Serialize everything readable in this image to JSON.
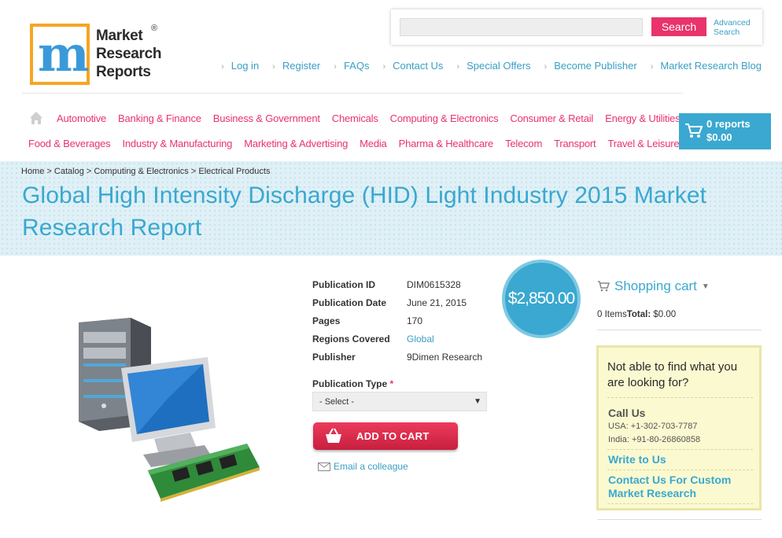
{
  "logo": {
    "line1": "Market",
    "line2": "Research",
    "line3": "Reports",
    "reg": "®"
  },
  "search": {
    "placeholder": "",
    "button": "Search",
    "advanced_line1": "Advanced",
    "advanced_line2": "Search"
  },
  "top_links": [
    "Log in",
    "Register",
    "FAQs",
    "Contact Us",
    "Special Offers",
    "Become Publisher",
    "Market Research Blog"
  ],
  "categories_row1": [
    "Automotive",
    "Banking & Finance",
    "Business & Government",
    "Chemicals",
    "Computing & Electronics",
    "Consumer & Retail",
    "Energy & Utilities"
  ],
  "categories_row2": [
    "Food & Beverages",
    "Industry & Manufacturing",
    "Marketing & Advertising",
    "Media",
    "Pharma & Healthcare",
    "Telecom",
    "Transport",
    "Travel & Leisure"
  ],
  "cart": {
    "reports": "0 reports",
    "total": "$0.00"
  },
  "breadcrumb": [
    "Home",
    "Catalog",
    "Computing & Electronics",
    "Electrical Products"
  ],
  "title": "Global High Intensity Discharge (HID) Light Industry 2015 Market Research Report",
  "info": [
    {
      "label": "Publication ID",
      "value": "DIM0615328"
    },
    {
      "label": "Publication Date",
      "value": "June 21, 2015"
    },
    {
      "label": "Pages",
      "value": "170"
    },
    {
      "label": "Regions Covered",
      "value": "Global"
    },
    {
      "label": "Publisher",
      "value": "9Dimen Research"
    }
  ],
  "price": "$2,850.00",
  "publication_type": {
    "label": "Publication Type",
    "required": "*",
    "selected": "- Select -"
  },
  "add_to_cart": "ADD TO CART",
  "email_colleague": "Email a colleague",
  "shopping_cart": {
    "title": "Shopping cart",
    "items": "0 Items",
    "total_label": "Total:",
    "total": "$0.00"
  },
  "help": {
    "question": "Not able to find what you are looking for?",
    "call_us": "Call Us",
    "usa": "USA: +1-302-703-7787",
    "india": "India: +91-80-26860858",
    "write": "Write to Us",
    "custom": "Contact Us For Custom Market Research"
  },
  "colors": {
    "accent_blue": "#3aa8d0",
    "accent_pink": "#e8336b",
    "logo_orange": "#f5a623"
  }
}
